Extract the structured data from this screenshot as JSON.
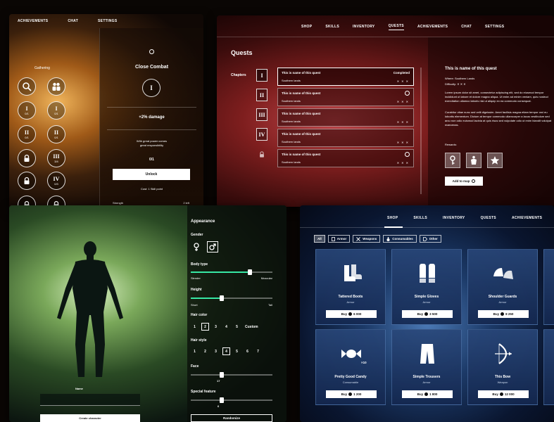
{
  "skills_panel": {
    "nav": [
      "ACHIEVEMENTS",
      "CHAT",
      "SETTINGS"
    ],
    "tree_label": "Gathering",
    "nodes": [
      {
        "roman": "I",
        "count": "0/1"
      },
      {
        "roman": "I",
        "count": "0/1"
      },
      {
        "roman": "II",
        "count": "0/1"
      },
      {
        "roman": "II",
        "count": "0/1"
      },
      {
        "roman": "III",
        "count": "3/4"
      },
      {
        "roman": "IV",
        "count": "0/3"
      }
    ],
    "detail": {
      "title": "Close Combat",
      "roman": "I",
      "bonus": "+2% damage",
      "quote_line1": "With great power comes",
      "quote_line2": "great responsibility",
      "progress": "0/1",
      "unlock_label": "Unlock",
      "cost": "Cost: 1 Skill point",
      "stat_label": "Strength",
      "stat_value": "2 left"
    }
  },
  "quests_panel": {
    "nav": [
      "SHOP",
      "SKILLS",
      "INVENTORY",
      "QUESTS",
      "ACHIEVEMENTS",
      "CHAT",
      "SETTINGS"
    ],
    "active_nav": "QUESTS",
    "title": "Quests",
    "chapters_label": "Chapters",
    "chapters": [
      "I",
      "II",
      "III",
      "IV"
    ],
    "quests": [
      {
        "name": "This is name of this quest",
        "region": "Southern lands",
        "status": "Completed",
        "difficulty": "✕ ✕ ✕"
      },
      {
        "name": "This is name of this quest",
        "region": "Southern lands",
        "status": "",
        "difficulty": "✕ ✕ ✕"
      },
      {
        "name": "This is name of this quest",
        "region": "Southern lands",
        "status": "",
        "difficulty": "✕ ✕ ✕"
      },
      {
        "name": "This is name of this quest",
        "region": "Southern lands",
        "status": "",
        "difficulty": "✕ ✕ ✕"
      },
      {
        "name": "This is name of this quest",
        "region": "Southern lands",
        "status": "",
        "difficulty": "✕ ✕ ✕"
      }
    ],
    "detail": {
      "title": "This is name of this quest",
      "where": "Where: Southern Lands",
      "difficulty": "Difficulty:  ✕ ✕ ✕",
      "body1": "Lorem ipsum dolor sit amet, consectetur adipiscing elit, sed do eiusmod tempor incididunt ut labore et dolore magna aliqua. Ut enim ad minim veniam, quis nostrud exercitation ullamco laboris nisi ut aliquip ex ea commodo consequat.",
      "body2": "Curabitur vitae nunc sed velit dignissim. Amet facilisis magna etiam tempor orci eu lobortis elementum. Dictum at tempor commodo ullamcorper a lacus vestibulum sed arcu non odio euismod lacinia at quis risus sed vulputate odio ut enim blandit volutpat maecenas.",
      "rewards_label": "Rewards:",
      "map_button": "Add to map"
    }
  },
  "appearance_panel": {
    "name_label": "Name",
    "create_label": "Create character",
    "title": "Appearance",
    "gender_label": "Gender",
    "body_type_label": "Body type",
    "body_type_value": 0.72,
    "body_min": "Slender",
    "body_max": "Muscular",
    "height_label": "Height",
    "height_value": 0.38,
    "height_min": "Short",
    "height_max": "Tall",
    "hair_color_label": "Hair color",
    "hair_colors": [
      "1",
      "2",
      "3",
      "4",
      "5"
    ],
    "hair_color_selected": "2",
    "hair_color_custom": "Custom",
    "hair_style_label": "Hair style",
    "hair_styles": [
      "1",
      "2",
      "3",
      "4",
      "5",
      "6",
      "7"
    ],
    "hair_style_selected": "4",
    "face_label": "Face",
    "face_value": "17",
    "face_fraction": 0.38,
    "special_label": "Special feature",
    "special_value": "6",
    "special_fraction": 0.38,
    "randomize_label": "Randomize"
  },
  "shop_panel": {
    "nav": [
      "SHOP",
      "SKILLS",
      "INVENTORY",
      "QUESTS",
      "ACHIEVEMENTS"
    ],
    "active_nav": "SHOP",
    "filters": [
      "All",
      "Armor",
      "Weapons",
      "Consumables",
      "Other"
    ],
    "items": [
      {
        "name": "Tattered Boots",
        "category": "Armor",
        "price": "6 000",
        "icon": "boots-icon"
      },
      {
        "name": "Simple Gloves",
        "category": "Armor",
        "price": "3 500",
        "icon": "gloves-icon"
      },
      {
        "name": "Shoulder Guards",
        "category": "Armor",
        "price": "8 250",
        "icon": "shoulder-guards-icon"
      },
      {
        "name": "Pretty Good Candy",
        "category": "Consumable",
        "price": "1 200",
        "icon": "candy-icon",
        "badge": "×10"
      },
      {
        "name": "Simple Trousers",
        "category": "Armor",
        "price": "1 800",
        "icon": "trousers-icon"
      },
      {
        "name": "This Bow",
        "category": "Weapon",
        "price": "12 000",
        "icon": "bow-icon"
      }
    ],
    "buy_label": "Buy"
  }
}
